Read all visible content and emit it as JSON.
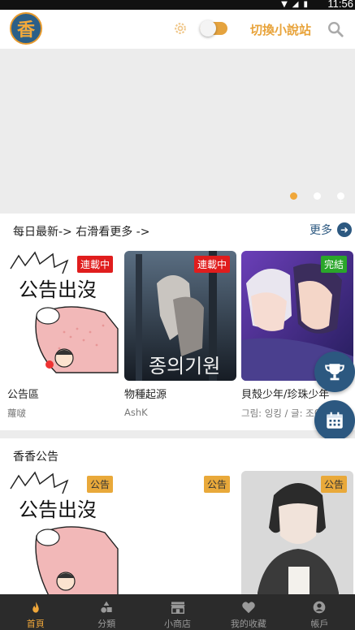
{
  "status_bar": {
    "time": "11:56"
  },
  "header": {
    "logo_text": "香",
    "switch_site_label": "切換小說站"
  },
  "banner": {
    "page_count": 3,
    "active_page": 1
  },
  "daily": {
    "title": "每日最新-> 右滑看更多 ->",
    "more_label": "更多",
    "items": [
      {
        "title": "公告區",
        "author": "蘿啵",
        "badge": "連載中",
        "cover_text": "公告出沒"
      },
      {
        "title": "物種起源",
        "author": "AshK",
        "badge": "連載中",
        "cover_text": "종의기원"
      },
      {
        "title": "貝殼少年/珍珠少年",
        "author": "그림: 잉킹 / 글: 조이",
        "badge": "完結",
        "cover_text": ""
      }
    ]
  },
  "notice": {
    "title": "香香公告",
    "items": [
      {
        "badge": "公告",
        "cover_text": "公告出沒"
      },
      {
        "badge": "公告",
        "cover_text": ""
      },
      {
        "badge": "公告",
        "cover_text": ""
      }
    ]
  },
  "bottom_nav": [
    {
      "label": "首頁",
      "icon": "flame-icon",
      "active": true
    },
    {
      "label": "分類",
      "icon": "shapes-icon",
      "active": false
    },
    {
      "label": "小商店",
      "icon": "store-icon",
      "active": false
    },
    {
      "label": "我的收藏",
      "icon": "heart-icon",
      "active": false
    },
    {
      "label": "帳戶",
      "icon": "user-icon",
      "active": false
    }
  ],
  "colors": {
    "accent": "#f0a73a",
    "brand_blue": "#2c5880",
    "red_badge": "#e01d1d",
    "green_badge": "#2aa62a"
  }
}
